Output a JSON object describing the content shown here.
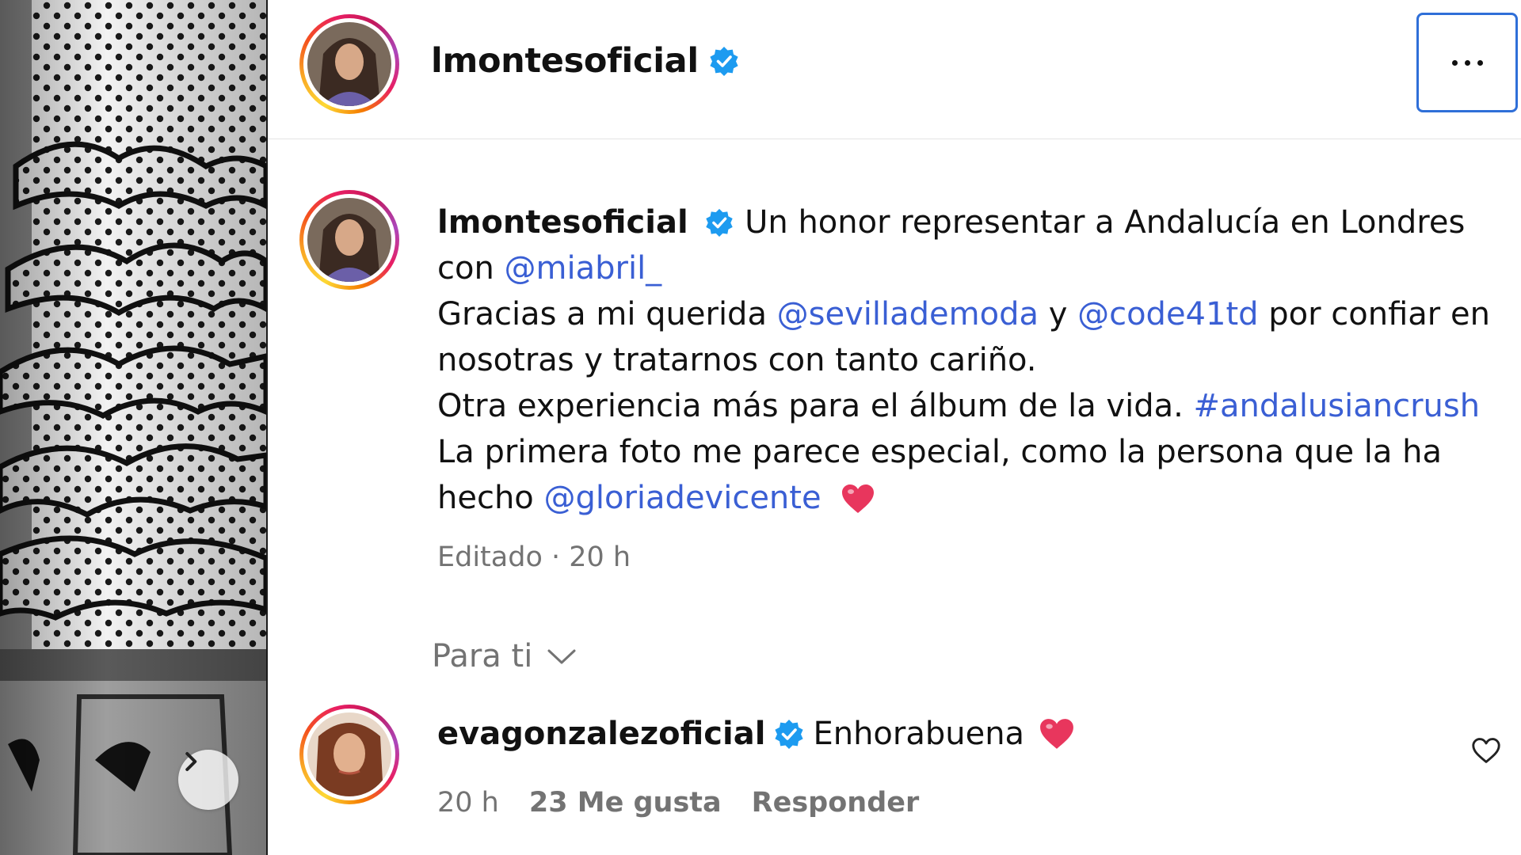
{
  "header": {
    "username": "lmontesoficial",
    "more_label": "More options"
  },
  "caption": {
    "username": "lmontesoficial",
    "line1_text": " Un honor representar a Andalucía en Londres con ",
    "mention_miabril": "@miabril_",
    "line2_text_a": "Gracias a mi querida ",
    "mention_sevilla": "@sevillademoda",
    "line2_text_b": " y ",
    "mention_code": "@code41td",
    "line2_text_c": " por confiar en nosotras y tratarnos con tanto cariño.",
    "line3_text": "Otra experiencia más para el álbum de la vida. ",
    "hashtag": "#andalusiancrush",
    "line4_text": "La primera foto me parece especial, como la persona que la ha hecho ",
    "mention_gloria": "@gloriadevicente",
    "emoji_heart": "❤️"
  },
  "meta": {
    "edited": "Editado",
    "separator": " · ",
    "time": "20 h"
  },
  "filter": {
    "label": "Para ti"
  },
  "comment": {
    "username": "evagonzalezoficial",
    "text": "Enhorabuena",
    "emoji": "❤️",
    "time": "20 h",
    "likes": "23 Me gusta",
    "reply": "Responder"
  },
  "icons": {
    "verified": "verified-badge-icon",
    "chevron": "chevron-down-icon",
    "heart": "heart-outline-icon",
    "next": "chevron-right-icon",
    "more": "more-horizontal-icon"
  },
  "colors": {
    "link": "#3a5fd4",
    "verified": "#1d9bf0",
    "muted": "#737373"
  }
}
